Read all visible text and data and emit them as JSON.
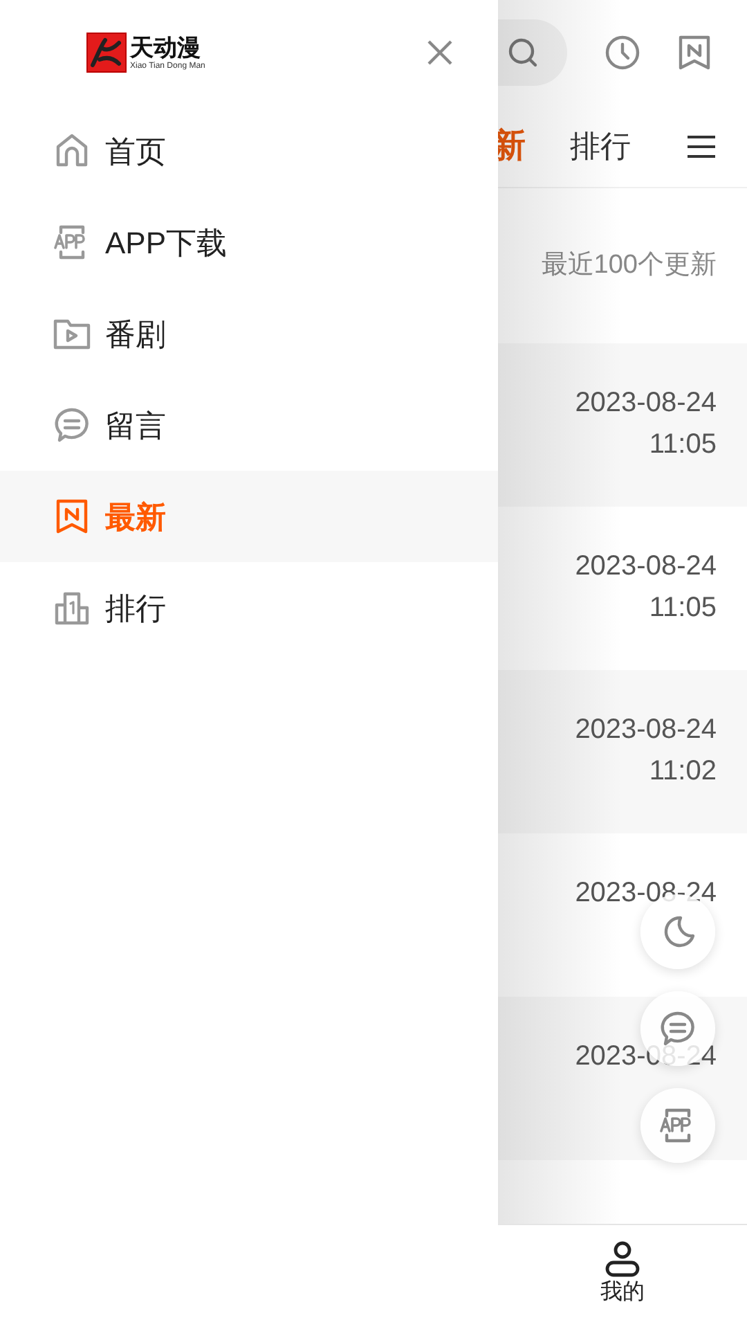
{
  "drawer": {
    "logo": {
      "title": "天动漫",
      "subtitle": "Xiao Tian Dong Man"
    },
    "menu": [
      {
        "kind": "home",
        "label": "首页",
        "selected": false
      },
      {
        "kind": "app",
        "label": "APP下载",
        "selected": false
      },
      {
        "kind": "folder",
        "label": "番剧",
        "selected": false
      },
      {
        "kind": "comment",
        "label": "留言",
        "selected": false
      },
      {
        "kind": "new",
        "label": "最新",
        "selected": true
      },
      {
        "kind": "rank",
        "label": "排行",
        "selected": false
      }
    ]
  },
  "page": {
    "tabs": [
      {
        "label": "新",
        "selected": true
      },
      {
        "label": "排行",
        "selected": false
      }
    ],
    "section_title": "最近100个更新",
    "rows": [
      {
        "date": "2023-08-24",
        "time": "11:05"
      },
      {
        "date": "2023-08-24",
        "time": "11:05"
      },
      {
        "date": "2023-08-24",
        "time": "11:02"
      },
      {
        "date": "2023-08-24"
      },
      {
        "date": "2023-08-24"
      }
    ]
  },
  "floating_buttons": [
    {
      "kind": "theme"
    },
    {
      "kind": "comment"
    },
    {
      "kind": "app"
    }
  ],
  "bottom_nav": [
    {
      "label": "我的"
    }
  ]
}
